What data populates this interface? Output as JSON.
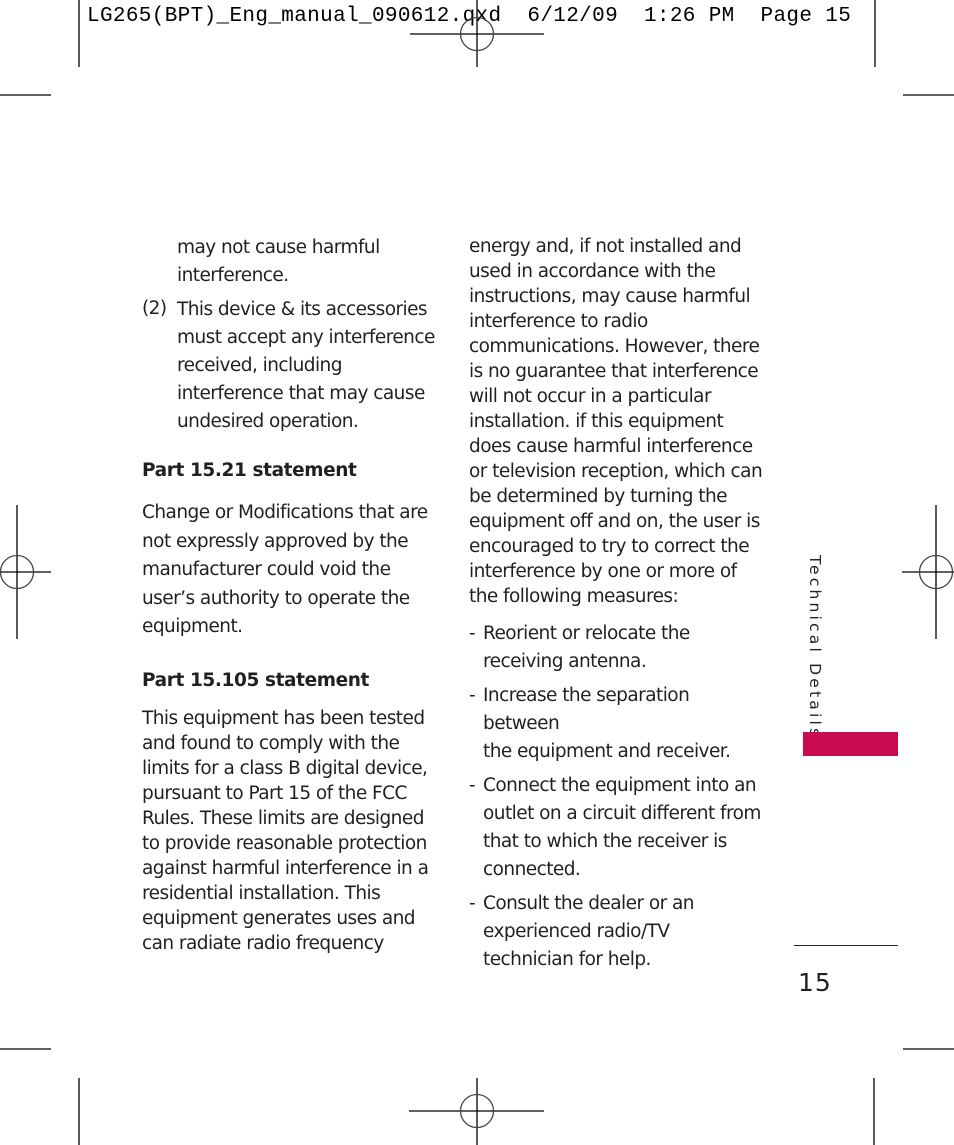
{
  "slug_line": "LG265(BPT)_Eng_manual_090612.qxd  6/12/09  1:26 PM  Page 15",
  "left_column": {
    "continuation": [
      "may not cause harmful",
      "interference."
    ],
    "item_2": {
      "number": "(2)",
      "lines": [
        "This device & its accessories",
        "must accept any interference",
        "received, including",
        "interference that may cause",
        "undesired operation."
      ]
    },
    "part_15_21": {
      "heading": "Part 15.21 statement",
      "lines": [
        "Change or Modifications that are",
        "not expressly approved by the",
        "manufacturer could void the",
        "user’s authority to operate the",
        "equipment."
      ]
    },
    "part_15_105": {
      "heading": "Part 15.105 statement",
      "lines": [
        "This equipment has been tested",
        "and found to comply with the",
        "limits for a class B digital device,",
        "pursuant to Part 15 of the FCC",
        "Rules. These limits are designed",
        "to provide reasonable protection",
        "against harmful interference in a",
        "residential installation. This",
        "equipment generates uses and",
        "can radiate radio frequency"
      ]
    }
  },
  "right_column": {
    "lines": [
      "energy and, if not installed and",
      "used in accordance with the",
      "instructions, may cause harmful",
      "interference to radio",
      "communications. However, there",
      "is no guarantee that interference",
      "will not occur in a particular",
      "installation. if this equipment",
      "does cause harmful interference",
      "or television reception, which can",
      "be determined by turning the",
      "equipment off and on, the user is",
      "encouraged to try to correct the",
      "interference by one or more of",
      "the following measures:"
    ],
    "measures": [
      {
        "dash": "-",
        "lines": [
          "Reorient or relocate the",
          "receiving antenna."
        ]
      },
      {
        "dash": "-",
        "lines": [
          "Increase the separation between",
          "the equipment and receiver."
        ]
      },
      {
        "dash": "-",
        "lines": [
          "Connect the equipment into an",
          "outlet on a circuit different from",
          "that to which the receiver is",
          "connected."
        ]
      },
      {
        "dash": "-",
        "lines": [
          "Consult the dealer or an",
          "experienced radio/TV",
          "technician for help."
        ]
      }
    ]
  },
  "section_tab": {
    "label": "Technical Details",
    "accent_color": "#c90c4f"
  },
  "page_number": "15"
}
